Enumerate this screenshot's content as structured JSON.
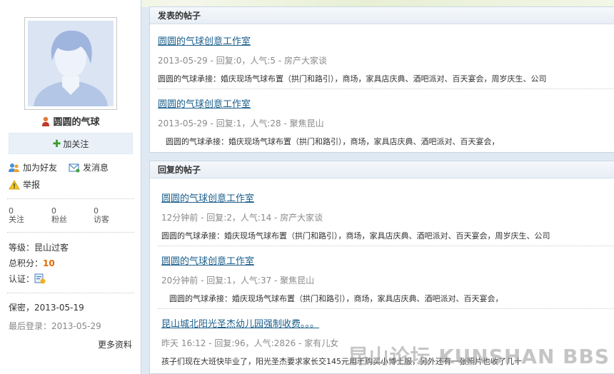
{
  "profile": {
    "username": "圆圆的气球",
    "follow_label": "加关注",
    "add_friend_label": "加为好友",
    "message_label": "发消息",
    "report_label": "举报",
    "stats": [
      {
        "value": "0",
        "label": "关注"
      },
      {
        "value": "0",
        "label": "粉丝"
      },
      {
        "value": "0",
        "label": "访客"
      }
    ],
    "level_label": "等级：",
    "level_value": "昆山过客",
    "points_label": "总积分：",
    "points_value": "10",
    "verify_label": "认证：",
    "confidential": "保密，2013-05-19",
    "last_login": "最后登录：2013-05-29",
    "more_label": "更多资料"
  },
  "posted": {
    "heading": "发表的帖子",
    "posts": [
      {
        "title": "圆圆的气球创意工作室",
        "meta": "2013-05-29 - 回复:0，人气:5 - 房产大家谈",
        "excerpt": "圆圆的气球承接：婚庆现场气球布置（拱门和路引），商场，家具店庆典、酒吧派对、百天宴会，周岁庆生、公司"
      },
      {
        "title": "圆圆的气球创意工作室",
        "meta": "2013-05-29 - 回复:1，人气:28 - 聚焦昆山",
        "excerpt": "　圆圆的气球承接：婚庆现场气球布置（拱门和路引），商场，家具店庆典、酒吧派对、百天宴会，"
      }
    ]
  },
  "replied": {
    "heading": "回复的帖子",
    "posts": [
      {
        "title": "圆圆的气球创意工作室",
        "meta": "12分钟前 - 回复:2，人气:14 - 房产大家谈",
        "excerpt": "圆圆的气球承接：婚庆现场气球布置（拱门和路引），商场，家具店庆典、酒吧派对、百天宴会，周岁庆生、公司"
      },
      {
        "title": "圆圆的气球创意工作室",
        "meta": "20分钟前 - 回复:1，人气:37 - 聚焦昆山",
        "excerpt": "　圆圆的气球承接：婚庆现场气球布置（拱门和路引），商场，家具店庆典、酒吧派对、百天宴会，"
      },
      {
        "title": "昆山城北阳光圣杰幼儿园强制收费。。。",
        "meta": "昨天 16:12 - 回复:96，人气:2826 - 家有儿女",
        "excerpt": "孩子们现在大班快毕业了，阳光圣杰要求家长交145元用于购买小博士服，另外还有一张照片也收了几十"
      }
    ]
  },
  "watermark": "昆山论坛 KUNSHAN BBS",
  "icons": {
    "user_icon": "user-icon",
    "add_friend_icon": "add-friend-icon",
    "message_icon": "message-icon",
    "warning_icon": "warning-icon",
    "verify_icon": "verify-icon"
  }
}
